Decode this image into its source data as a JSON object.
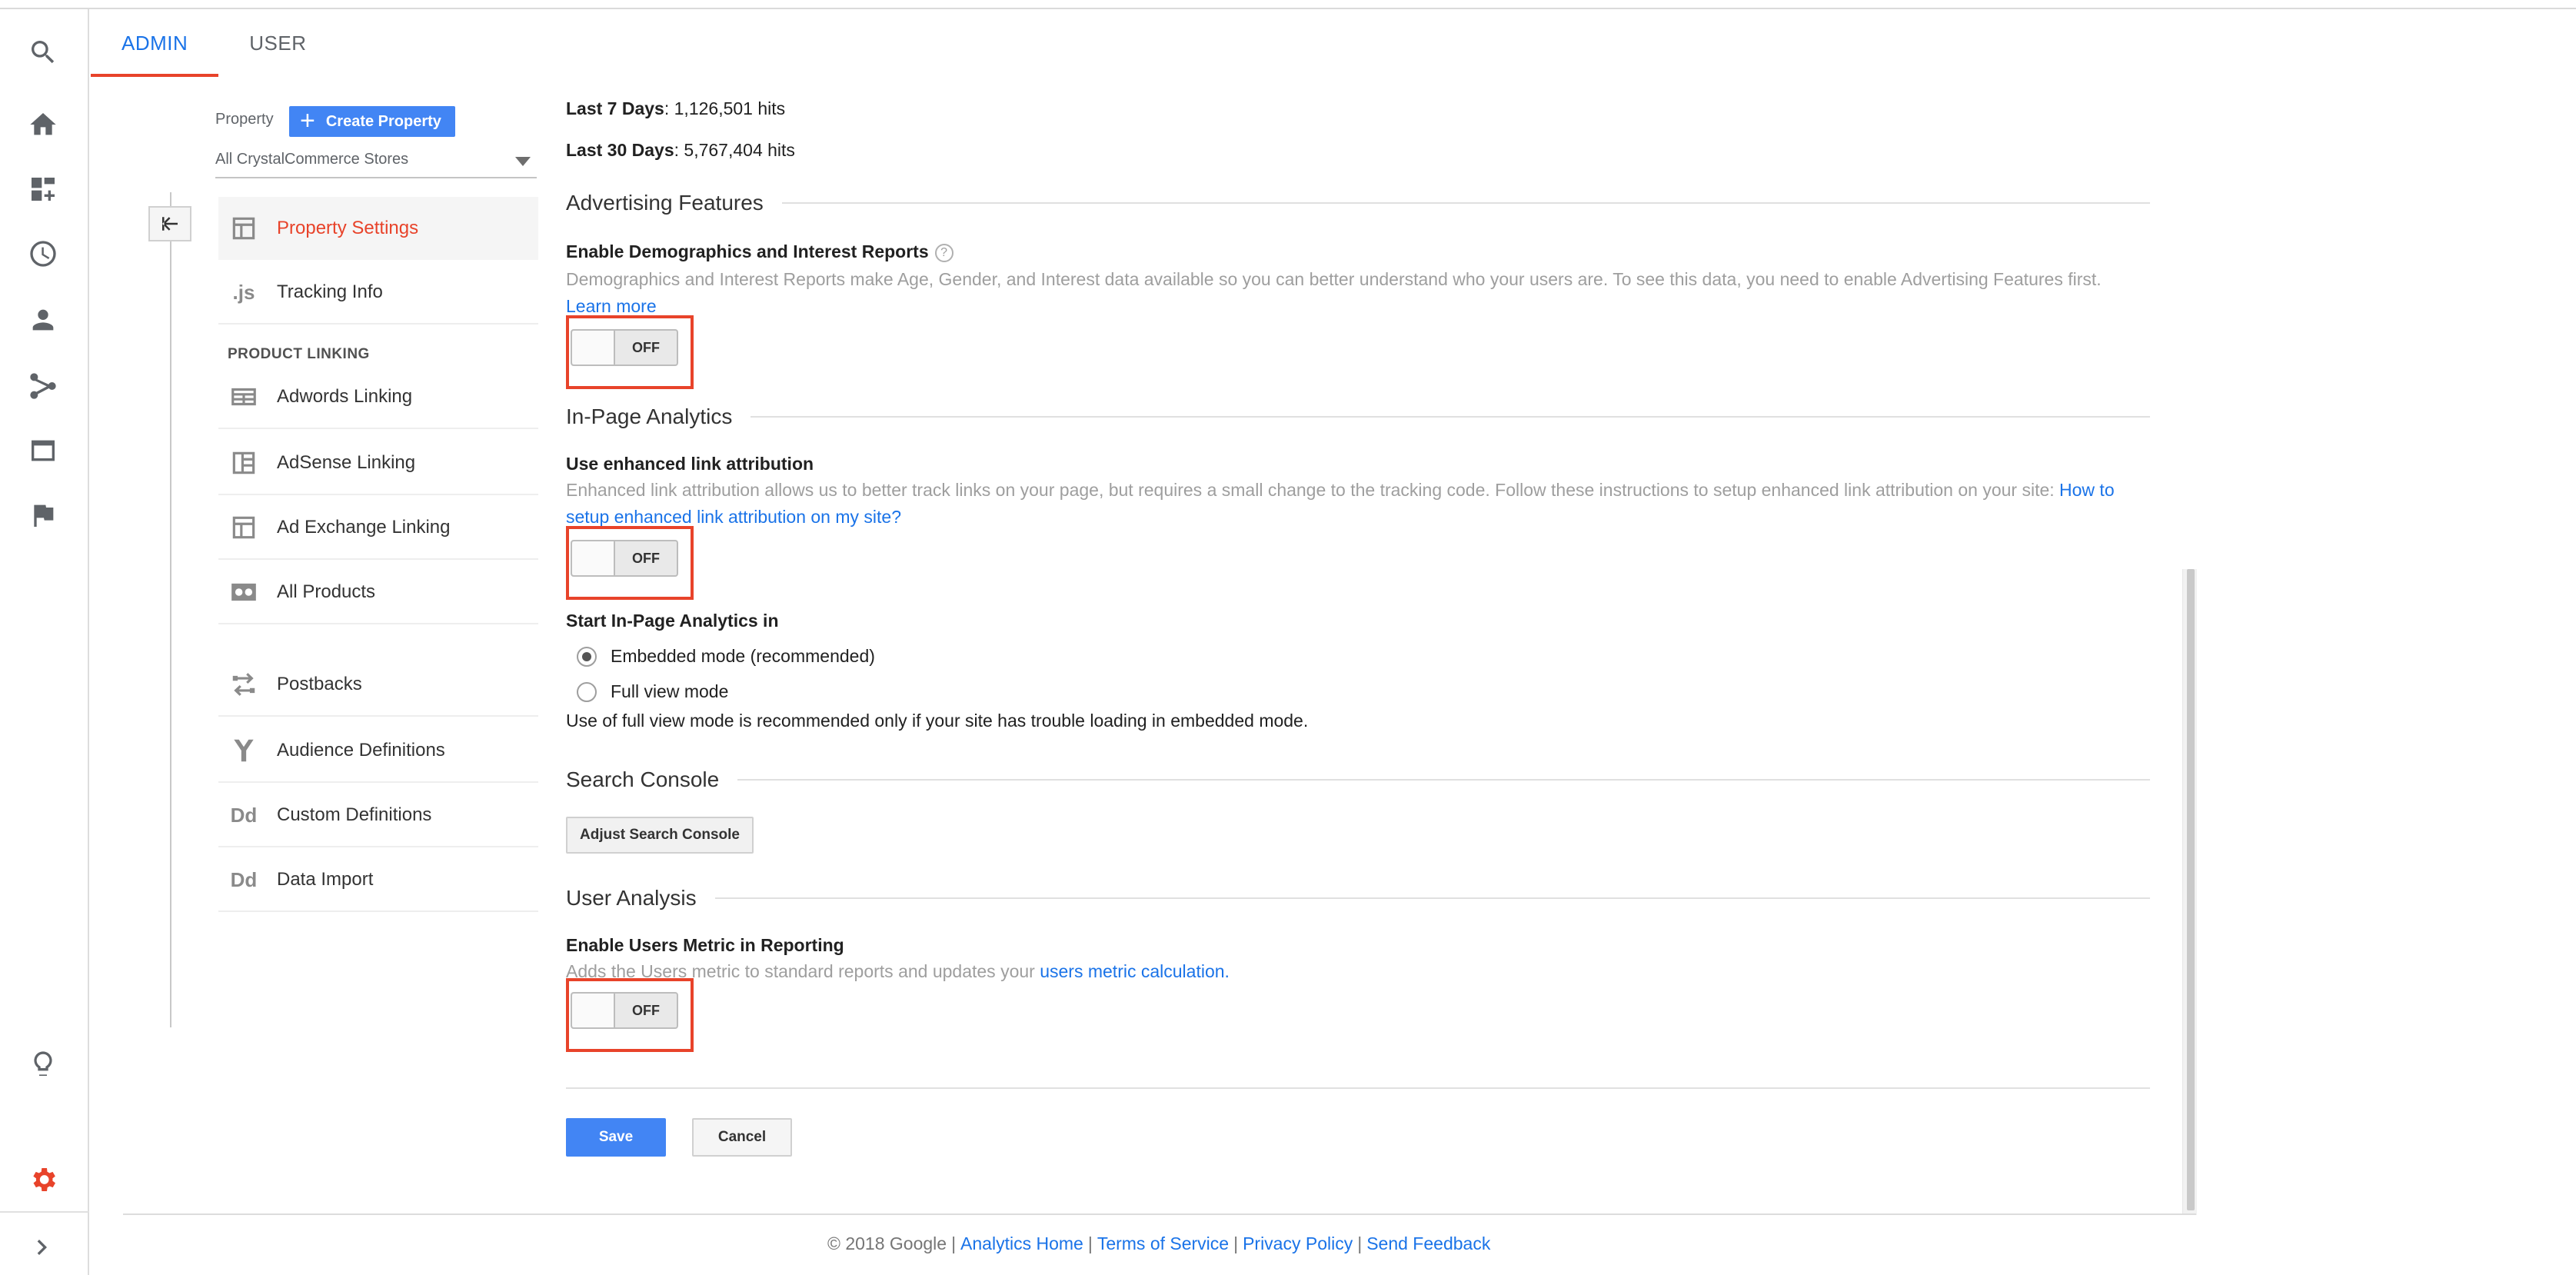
{
  "tabs": [
    {
      "label": "ADMIN",
      "active": true
    },
    {
      "label": "USER",
      "active": false
    }
  ],
  "rail": {
    "icons": [
      "search-icon",
      "home-icon",
      "customization-icon",
      "clock-icon",
      "person-icon",
      "acquisition-icon",
      "behavior-icon",
      "flag-icon",
      "lightbulb-icon",
      "gear-icon",
      "chevron-right-icon"
    ],
    "active_color": "#e8432a"
  },
  "property": {
    "label": "Property",
    "create_button": "Create Property",
    "selected": "All CrystalCommerce Stores"
  },
  "nav": {
    "items_top": [
      {
        "label": "Property Settings",
        "icon": "property-settings-icon",
        "active": true
      },
      {
        "label": "Tracking Info",
        "icon": "js-icon",
        "glyph": ".js"
      }
    ],
    "section_label": "PRODUCT LINKING",
    "items_linking": [
      {
        "label": "Adwords Linking",
        "icon": "adwords-icon"
      },
      {
        "label": "AdSense Linking",
        "icon": "adsense-icon"
      },
      {
        "label": "Ad Exchange Linking",
        "icon": "ad-exchange-icon"
      },
      {
        "label": "All Products",
        "icon": "all-products-icon"
      }
    ],
    "items_bottom": [
      {
        "label": "Postbacks",
        "icon": "postbacks-icon"
      },
      {
        "label": "Audience Definitions",
        "icon": "audience-icon"
      },
      {
        "label": "Custom Definitions",
        "icon": "dd-icon",
        "glyph": "Dd"
      },
      {
        "label": "Data Import",
        "icon": "dd-icon",
        "glyph": "Dd"
      }
    ]
  },
  "stats": {
    "last7_label": "Last 7 Days",
    "last7_value": ": 1,126,501 hits",
    "last30_label": "Last 30 Days",
    "last30_value": ": 5,767,404 hits"
  },
  "advertising": {
    "section": "Advertising Features",
    "title": "Enable Demographics and Interest Reports",
    "help": "?",
    "desc": "Demographics and Interest Reports make Age, Gender, and Interest data available so you can better understand who your users are. To see this data, you need to enable Advertising Features first.",
    "link": "Learn more",
    "toggle": "OFF"
  },
  "inpage": {
    "section": "In-Page Analytics",
    "title": "Use enhanced link attribution",
    "desc": "Enhanced link attribution allows us to better track links on your page, but requires a small change to the tracking code. Follow these instructions to setup enhanced link attribution on your site:",
    "link": "How to setup enhanced link attribution on my site?",
    "toggle": "OFF",
    "start_label": "Start In-Page Analytics in",
    "options": [
      {
        "label": "Embedded mode (recommended)",
        "selected": true
      },
      {
        "label": "Full view mode",
        "selected": false
      }
    ],
    "note": "Use of full view mode is recommended only if your site has trouble loading in embedded mode."
  },
  "search_console": {
    "section": "Search Console",
    "button": "Adjust Search Console"
  },
  "user_analysis": {
    "section": "User Analysis",
    "title": "Enable Users Metric in Reporting",
    "desc": "Adds the Users metric to standard reports and updates your",
    "link": "users metric calculation.",
    "toggle": "OFF"
  },
  "actions": {
    "save": "Save",
    "cancel": "Cancel"
  },
  "footer": {
    "copyright": "© 2018 Google",
    "links": [
      "Analytics Home",
      "Terms of Service",
      "Privacy Policy",
      "Send Feedback"
    ]
  },
  "colors": {
    "accent_blue": "#4285f4",
    "link_blue": "#1a73e8",
    "highlight_red": "#e8432a"
  }
}
